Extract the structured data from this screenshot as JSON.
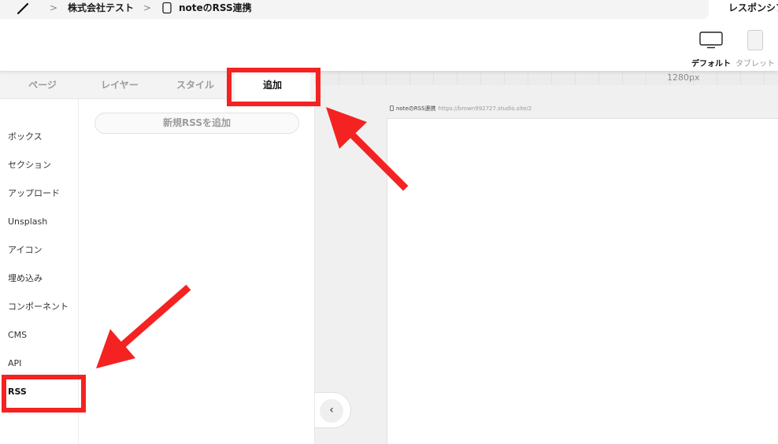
{
  "breadcrumb": {
    "company": "株式会社テスト",
    "page": "noteのRSS連携",
    "separator": ">"
  },
  "header_right": {
    "responsive_label": "レスポンシブ",
    "devices": [
      {
        "label": "デフォルト",
        "icon": "monitor-icon",
        "active": true
      },
      {
        "label": "タブレット",
        "icon": "tablet-icon",
        "active": false
      }
    ]
  },
  "tabs": [
    {
      "label": "ページ",
      "active": false
    },
    {
      "label": "レイヤー",
      "active": false
    },
    {
      "label": "スタイル",
      "active": false
    },
    {
      "label": "追加",
      "active": true
    }
  ],
  "categories": [
    {
      "label": "ボックス"
    },
    {
      "label": "セクション"
    },
    {
      "label": "アップロード"
    },
    {
      "label": "Unsplash"
    },
    {
      "label": "アイコン"
    },
    {
      "label": "埋め込み"
    },
    {
      "label": "コンポーネント"
    },
    {
      "label": "CMS"
    },
    {
      "label": "API"
    },
    {
      "label": "RSS",
      "selected": true
    }
  ],
  "add_rss_button": "新規RSSを追加",
  "canvas": {
    "width_label": "1280px",
    "site_title": "noteのRSS連携",
    "site_url": "https://brown992727.studio.site/2",
    "collapse_glyph": "‹"
  },
  "colors": {
    "annotation_red": "#f52222",
    "tab_bg": "#f3f3f3",
    "canvas_bg": "#f0f0f0"
  }
}
